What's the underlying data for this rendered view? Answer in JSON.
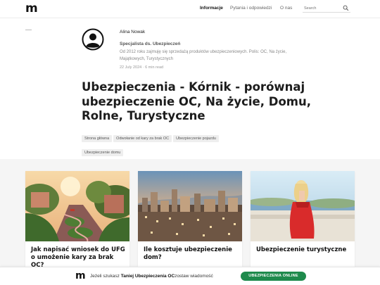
{
  "header": {
    "logo": "m",
    "nav": [
      {
        "label": "Informacje",
        "active": true
      },
      {
        "label": "Pytania i odpowiedzi",
        "active": false
      },
      {
        "label": "O nas",
        "active": false
      }
    ],
    "search_placeholder": "Search",
    "search_icon": "search-icon"
  },
  "author": {
    "avatar_icon": "user-avatar-icon",
    "name": "Alina Nowak",
    "role": "Specjalista ds. Ubezpieczeń",
    "bio": "Od 2012 roku zajmuję się sprzedażą produktów ubezpieczeniowych. Polis: OC, Na życie, Majątkowych, Turystycznych",
    "meta": "22 July 2024 · 6 min read"
  },
  "article": {
    "title": "Ubezpieczenia - Kórnik - porównaj ubezpieczenie OC, Na życie, Domu, Rolne, Turystyczne"
  },
  "tags": [
    "Strona główna",
    "Odwołanie od kary za brak OC",
    "Ubezpieczenie pojazdu",
    "Ubezpieczenie domu"
  ],
  "cards": [
    {
      "title": "Jak napisać wniosek do UFG o umożenie kary za brak OC?"
    },
    {
      "title": "Ile kosztuje ubezpieczenie dom?"
    },
    {
      "title": "Ubezpieczenie turystyczne"
    }
  ],
  "banner": {
    "logo": "m",
    "text_before": "Jeżeli szukasz ",
    "text_bold": "Taniej Ubezpieczenia OC",
    "text_after": "zostaw wiadomość",
    "button": "UBEZPIECZENIA ONLINE"
  },
  "colors": {
    "accent_button": "#1e8a4c",
    "section_bg": "#f5f5f5"
  }
}
